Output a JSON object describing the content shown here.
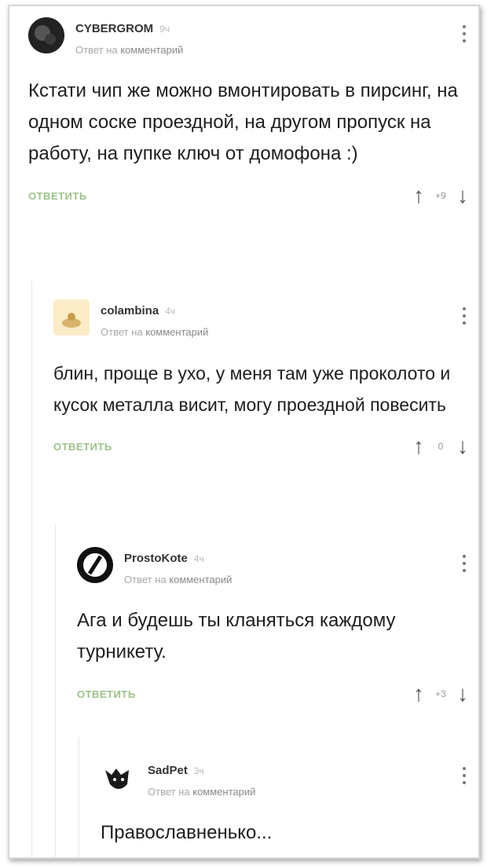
{
  "comments": [
    {
      "author": "CYBERGROM",
      "time": "9ч",
      "reply_prefix": "Ответ на",
      "reply_target": "комментарий",
      "text": "Кстати чип же можно вмонтировать в пирсинг, на одном соске проездной, на другом пропуск на работу, на пупке ключ от домофона :)",
      "reply_label": "ОТВЕТИТЬ",
      "rating": "+9"
    },
    {
      "author": "colambina",
      "time": "4ч",
      "reply_prefix": "Ответ на",
      "reply_target": "комментарий",
      "text": "блин, проще в ухо, у меня там уже проколото и кусок металла висит, могу проездной повесить",
      "reply_label": "ОТВЕТИТЬ",
      "rating": "0"
    },
    {
      "author": "ProstoKote",
      "time": "4ч",
      "reply_prefix": "Ответ на",
      "reply_target": "комментарий",
      "text": "Ага и будешь ты кланяться каждому турникету.",
      "reply_label": "ОТВЕТИТЬ",
      "rating": "+3"
    },
    {
      "author": "SadPet",
      "time": "3ч",
      "reply_prefix": "Ответ на",
      "reply_target": "комментарий",
      "text": "Православненько..."
    }
  ],
  "colors": {
    "reply_button": "#9cc28a",
    "text": "#1e1e1e",
    "meta": "#a8a8a8"
  }
}
